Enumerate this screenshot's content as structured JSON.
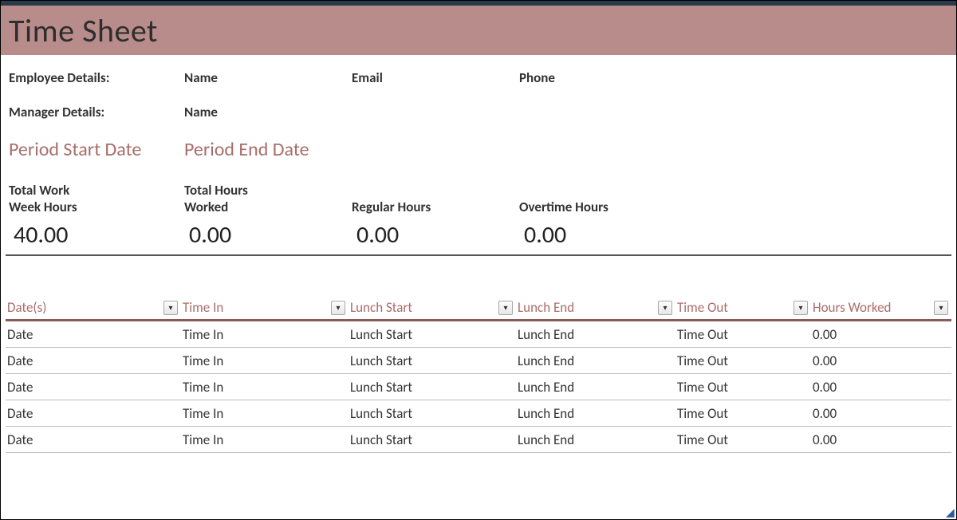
{
  "title": "Time Sheet",
  "details": {
    "employee_label": "Employee Details:",
    "manager_label": "Manager Details:",
    "name_label": "Name",
    "email_label": "Email",
    "phone_label": "Phone"
  },
  "period": {
    "start_label": "Period Start Date",
    "end_label": "Period End Date"
  },
  "totals": {
    "work_week_label_1": "Total Work",
    "work_week_label_2": "Week Hours",
    "hours_worked_label_1": "Total Hours",
    "hours_worked_label_2": "Worked",
    "regular_label": "Regular Hours",
    "overtime_label": "Overtime Hours",
    "work_week_value": "40.00",
    "hours_worked_value": "0.00",
    "regular_value": "0.00",
    "overtime_value": "0.00"
  },
  "table": {
    "headers": {
      "date": "Date(s)",
      "time_in": "Time In",
      "lunch_start": "Lunch Start",
      "lunch_end": "Lunch End",
      "time_out": "Time Out",
      "hours_worked": "Hours Worked"
    },
    "rows": [
      {
        "date": "Date",
        "time_in": "Time In",
        "lunch_start": "Lunch Start",
        "lunch_end": "Lunch End",
        "time_out": "Time Out",
        "hours_worked": "0.00"
      },
      {
        "date": "Date",
        "time_in": "Time In",
        "lunch_start": "Lunch Start",
        "lunch_end": "Lunch End",
        "time_out": "Time Out",
        "hours_worked": "0.00"
      },
      {
        "date": "Date",
        "time_in": "Time In",
        "lunch_start": "Lunch Start",
        "lunch_end": "Lunch End",
        "time_out": "Time Out",
        "hours_worked": "0.00"
      },
      {
        "date": "Date",
        "time_in": "Time In",
        "lunch_start": "Lunch Start",
        "lunch_end": "Lunch End",
        "time_out": "Time Out",
        "hours_worked": "0.00"
      },
      {
        "date": "Date",
        "time_in": "Time In",
        "lunch_start": "Lunch Start",
        "lunch_end": "Lunch End",
        "time_out": "Time Out",
        "hours_worked": "0.00"
      }
    ]
  }
}
